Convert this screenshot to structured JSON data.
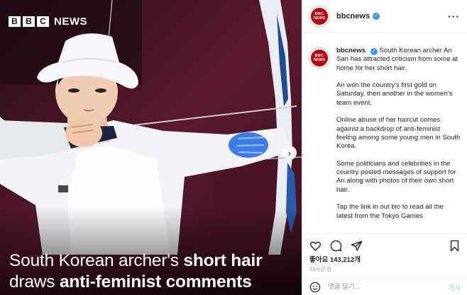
{
  "image": {
    "logo": {
      "block1": "B",
      "block2": "B",
      "block3": "C",
      "word": "NEWS"
    },
    "headline": {
      "part1": "South Korean archer's ",
      "part2_bold": "short hair",
      "part3": "draws ",
      "part4_bold": "anti-feminist comments"
    },
    "next_icon": "chevron-right-icon",
    "next_glyph": "›"
  },
  "header": {
    "avatar_line1": "BBC",
    "avatar_line2": "NEWS",
    "username": "bbcnews",
    "verified_glyph": "✓",
    "more_glyph": "···"
  },
  "caption": {
    "username": "bbcnews",
    "paragraphs": [
      "South Korean archer An San has attracted criticism from some at home for her short hair.",
      "An won the country's first gold on Saturday, then another in the women's team event.",
      "Online abuse of her haircut comes against a backdrop of anti-feminist feeling among some young men in South Korea.",
      "Some politicians and celebrities in the country posted messages of support for An along with photos of their own short hair.",
      "Tap the link in out bio to read all the latest from the Tokyo Games"
    ]
  },
  "actions": {
    "icons": [
      "heart-icon",
      "comment-icon",
      "share-icon",
      "bookmark-icon"
    ]
  },
  "likes": "좋아요 143,212개",
  "time": "15시간 전",
  "comment": {
    "placeholder": "댓글 달기...",
    "post_label": "게시"
  },
  "colors": {
    "bbc_red": "#b8000e",
    "verified_blue": "#3897f0",
    "post_button": "#b2dffc",
    "photo_background": "#1b0c12"
  }
}
